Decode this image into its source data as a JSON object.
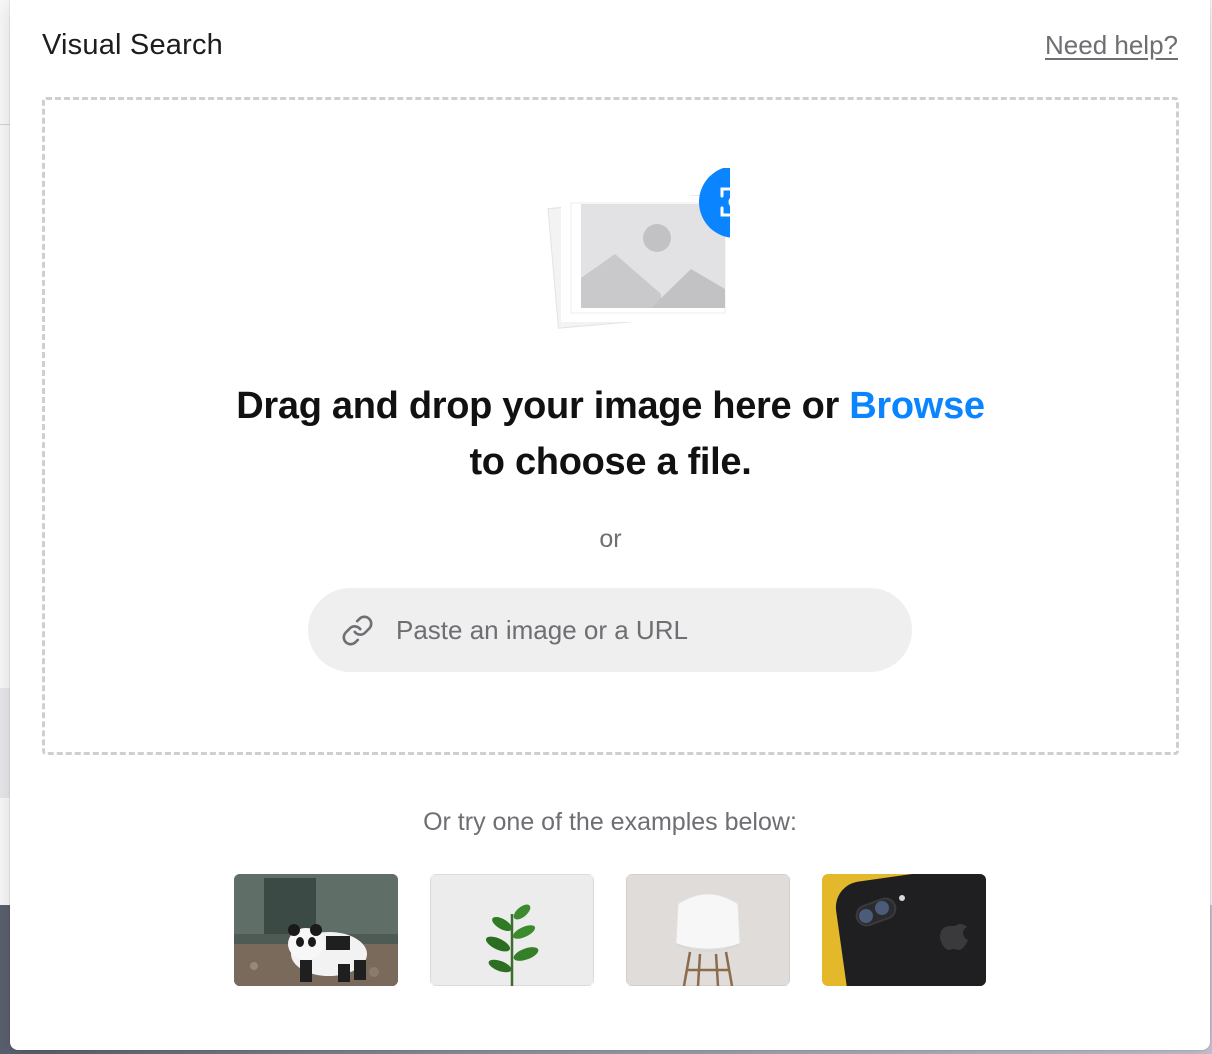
{
  "dialog": {
    "title": "Visual Search",
    "help_link": "Need help?"
  },
  "drop_zone": {
    "headline_part1": "Drag and drop your image here or ",
    "browse_link": "Browse",
    "headline_part2": "to choose a file.",
    "or_label": "or",
    "url_input": {
      "placeholder": "Paste an image or a URL",
      "value": ""
    },
    "illustration_icon": "image-placeholder-icon",
    "scan_badge_icon": "visual-scan-icon",
    "link_icon": "link-icon"
  },
  "examples": {
    "label": "Or try one of the examples below:",
    "items": [
      {
        "subject": "panda"
      },
      {
        "subject": "plant"
      },
      {
        "subject": "chair"
      },
      {
        "subject": "phone"
      }
    ]
  },
  "colors": {
    "accent": "#0a84ff",
    "muted_text": "#6e6e73",
    "field_background": "#efefef",
    "dashed_border": "#cfcfd2"
  }
}
